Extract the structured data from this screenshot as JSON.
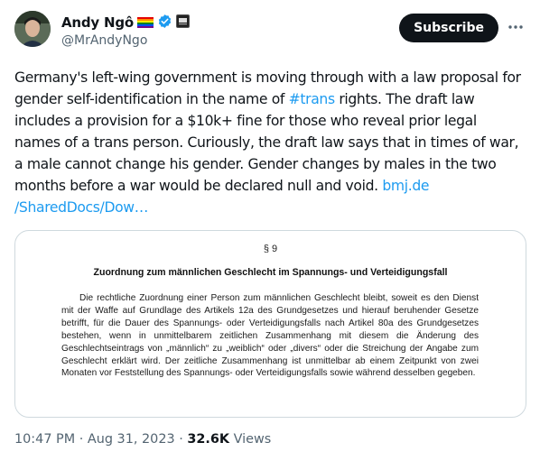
{
  "author": {
    "display_name": "Andy Ngô",
    "handle": "@MrAndyNgo",
    "badges": [
      "rainbow-flag-icon",
      "verified-check-icon",
      "affiliate-badge-icon"
    ]
  },
  "subscribe_label": "Subscribe",
  "tweet": {
    "text_1": "Germany's left-wing government is moving through with a law proposal for gender self-identification in the name of ",
    "hashtag": "#trans",
    "text_2": " rights. The draft law includes a provision for a $10k+ fine for those who reveal prior legal names of a trans person. Curiously, the draft law says that in times of war, a male cannot change his gender. Gender changes by males in the two months before a war would be declared null and void. ",
    "link_text": "bmj.de\n/SharedDocs/Dow…"
  },
  "document": {
    "section": "§ 9",
    "heading": "Zuordnung zum männlichen Geschlecht im Spannungs- und Verteidigungsfall",
    "body": "Die rechtliche Zuordnung einer Person zum männlichen Geschlecht bleibt, soweit es den Dienst mit der Waffe auf Grundlage des Artikels 12a des Grundgesetzes und hierauf beruhender Gesetze betrifft, für die Dauer des Spannungs- oder Verteidigungsfalls nach Artikel 80a des Grundgesetzes bestehen, wenn in unmittelbarem zeitlichen Zusammenhang mit diesem die Änderung des Geschlechtseintrags von „männlich“ zu „weiblich“ oder „divers“ oder die Streichung der Angabe zum Geschlecht erklärt wird. Der zeitliche Zusammenhang ist unmittelbar ab einem Zeitpunkt von zwei Monaten vor Feststellung des Spannungs- oder Verteidigungsfalls sowie während desselben gegeben."
  },
  "meta": {
    "time": "10:47 PM",
    "separator": " · ",
    "date": "Aug 31, 2023",
    "views_count": "32.6K",
    "views_label": " Views"
  },
  "colors": {
    "link": "#1d9bf0",
    "verified": "#1d9bf0",
    "text": "#0f1419",
    "secondary": "#536471",
    "border": "#cfd9de"
  }
}
